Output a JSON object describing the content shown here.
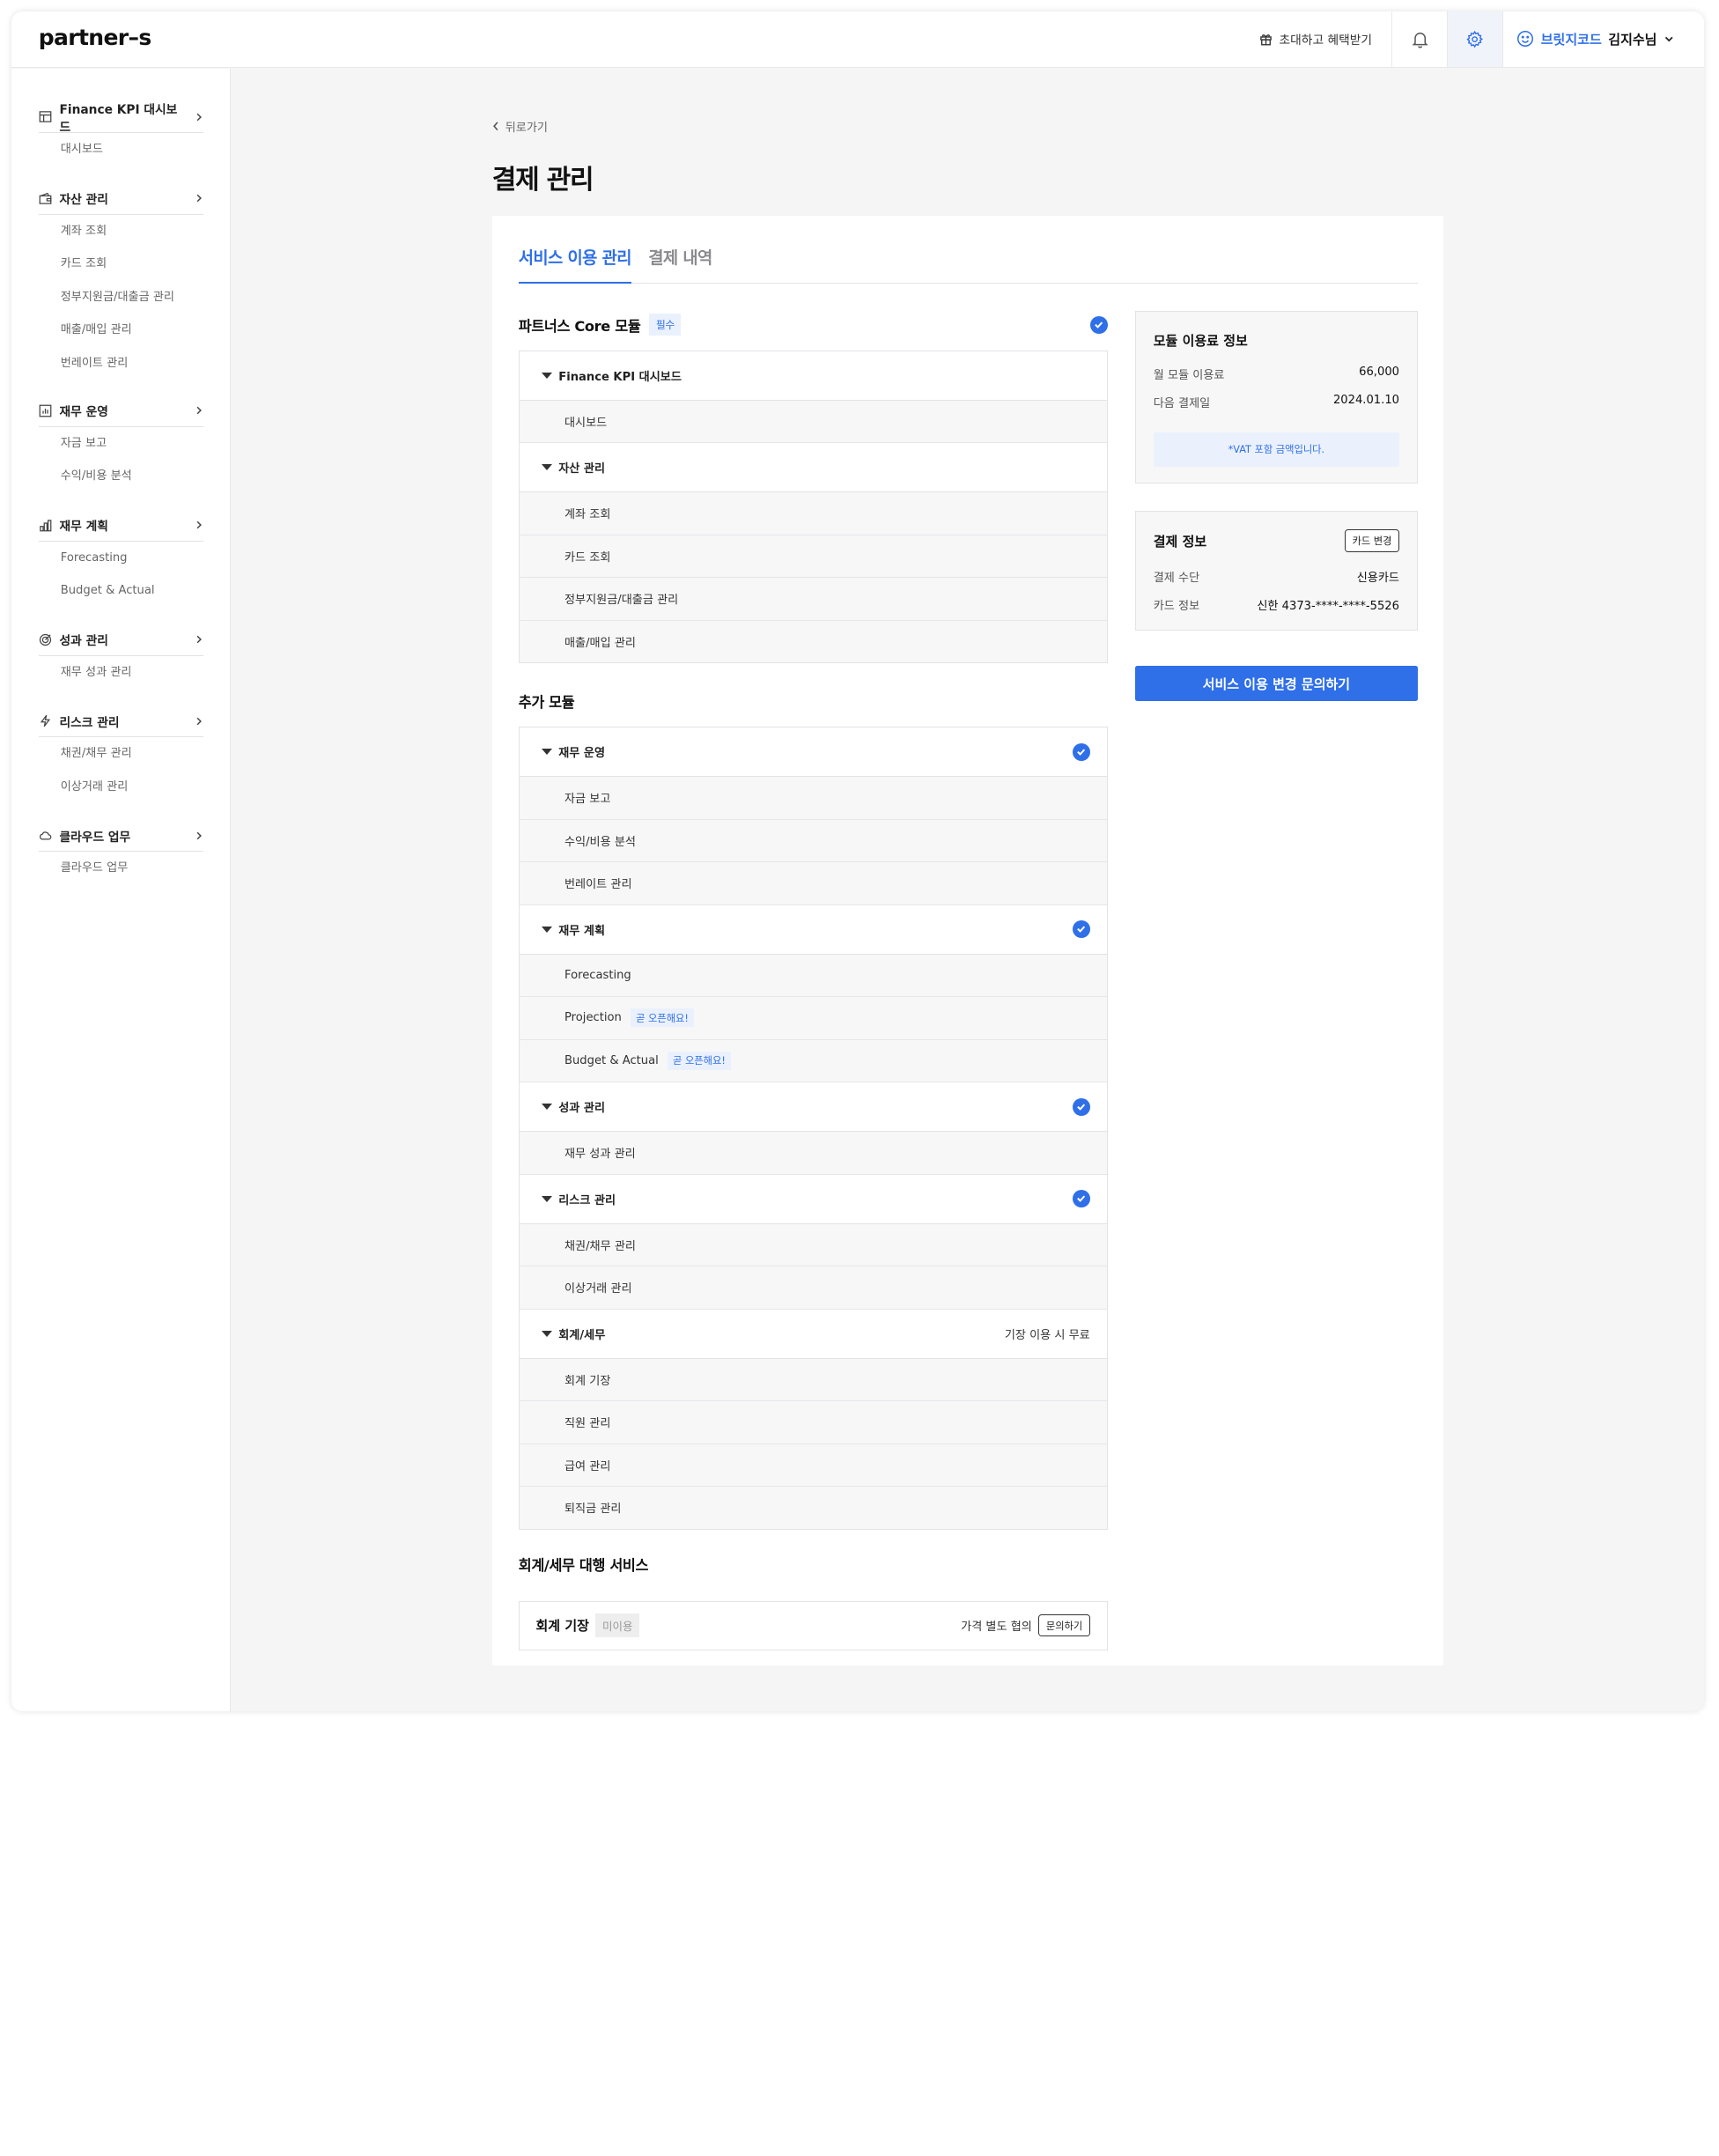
{
  "header": {
    "logo": "partner–s",
    "invite_label": "초대하고 혜택받기",
    "company": "브릿지코드",
    "user_name": "김지수님"
  },
  "sidebar": {
    "groups": [
      {
        "label": "Finance KPI 대시보드",
        "icon": "layout-icon",
        "items": [
          "대시보드"
        ]
      },
      {
        "label": "자산 관리",
        "icon": "wallet-icon",
        "items": [
          "계좌 조회",
          "카드 조회",
          "정부지원금/대출금 관리",
          "매출/매입 관리",
          "번레이트 관리"
        ]
      },
      {
        "label": "재무 운영",
        "icon": "chart-box-icon",
        "items": [
          "자금 보고",
          "수익/비용 분석"
        ]
      },
      {
        "label": "재무 계획",
        "icon": "bar-chart-icon",
        "items": [
          "Forecasting",
          "Budget & Actual"
        ]
      },
      {
        "label": "성과 관리",
        "icon": "target-icon",
        "items": [
          "재무 성과 관리"
        ]
      },
      {
        "label": "리스크 관리",
        "icon": "bolt-icon",
        "items": [
          "채권/채무 관리",
          "이상거래 관리"
        ]
      },
      {
        "label": "클라우드 업무",
        "icon": "cloud-icon",
        "items": [
          "클라우드 업무"
        ]
      }
    ]
  },
  "page": {
    "back_label": "뒤로가기",
    "title": "결제 관리",
    "tabs": [
      {
        "label": "서비스 이용 관리",
        "active": true
      },
      {
        "label": "결제 내역",
        "active": false
      }
    ]
  },
  "core": {
    "title": "파트너스 Core 모듈",
    "badge": "필수",
    "modules": [
      {
        "label": "Finance KPI 대시보드",
        "items": [
          "대시보드"
        ]
      },
      {
        "label": "자산 관리",
        "items": [
          "계좌 조회",
          "카드 조회",
          "정부지원금/대출금 관리",
          "매출/매입 관리"
        ]
      }
    ]
  },
  "addon": {
    "title": "추가 모듈",
    "modules": [
      {
        "label": "재무 운영",
        "checked": true,
        "items": [
          "자금 보고",
          "수익/비용 분석",
          "번레이트 관리"
        ]
      },
      {
        "label": "재무 계획",
        "checked": true,
        "items": [
          "Forecasting",
          "Projection",
          "Budget & Actual"
        ],
        "soon_label": "곧 오픈해요!"
      },
      {
        "label": "성과 관리",
        "checked": true,
        "items": [
          "재무 성과 관리"
        ]
      },
      {
        "label": "리스크 관리",
        "checked": true,
        "items": [
          "채권/채무 관리",
          "이상거래 관리"
        ]
      },
      {
        "label": "회계/세무",
        "checked": false,
        "note": "기장 이용 시 무료",
        "items": [
          "회계 기장",
          "직원 관리",
          "급여 관리",
          "퇴직금 관리"
        ]
      }
    ]
  },
  "agency": {
    "title": "회계/세무 대행 서비스",
    "service": "회계 기장",
    "status": "미이용",
    "price": "가격 별도 협의",
    "inquiry_label": "문의하기"
  },
  "fee_card": {
    "title": "모듈 이용료 정보",
    "monthly_label": "월 모듈 이용료",
    "monthly_value": "66,000",
    "next_label": "다음 결제일",
    "next_value": "2024.01.10",
    "vat_note": "*VAT 포함 금액입니다."
  },
  "pay_card": {
    "title": "결제 정보",
    "change_label": "카드 변경",
    "method_label": "결제 수단",
    "method_value": "신용카드",
    "card_label": "카드 정보",
    "card_value": "신한 4373-****-****-5526"
  },
  "cta_label": "서비스 이용 변경 문의하기",
  "colors": {
    "accent": "#2f6fe8",
    "accent_soft": "#eaf1fd"
  }
}
